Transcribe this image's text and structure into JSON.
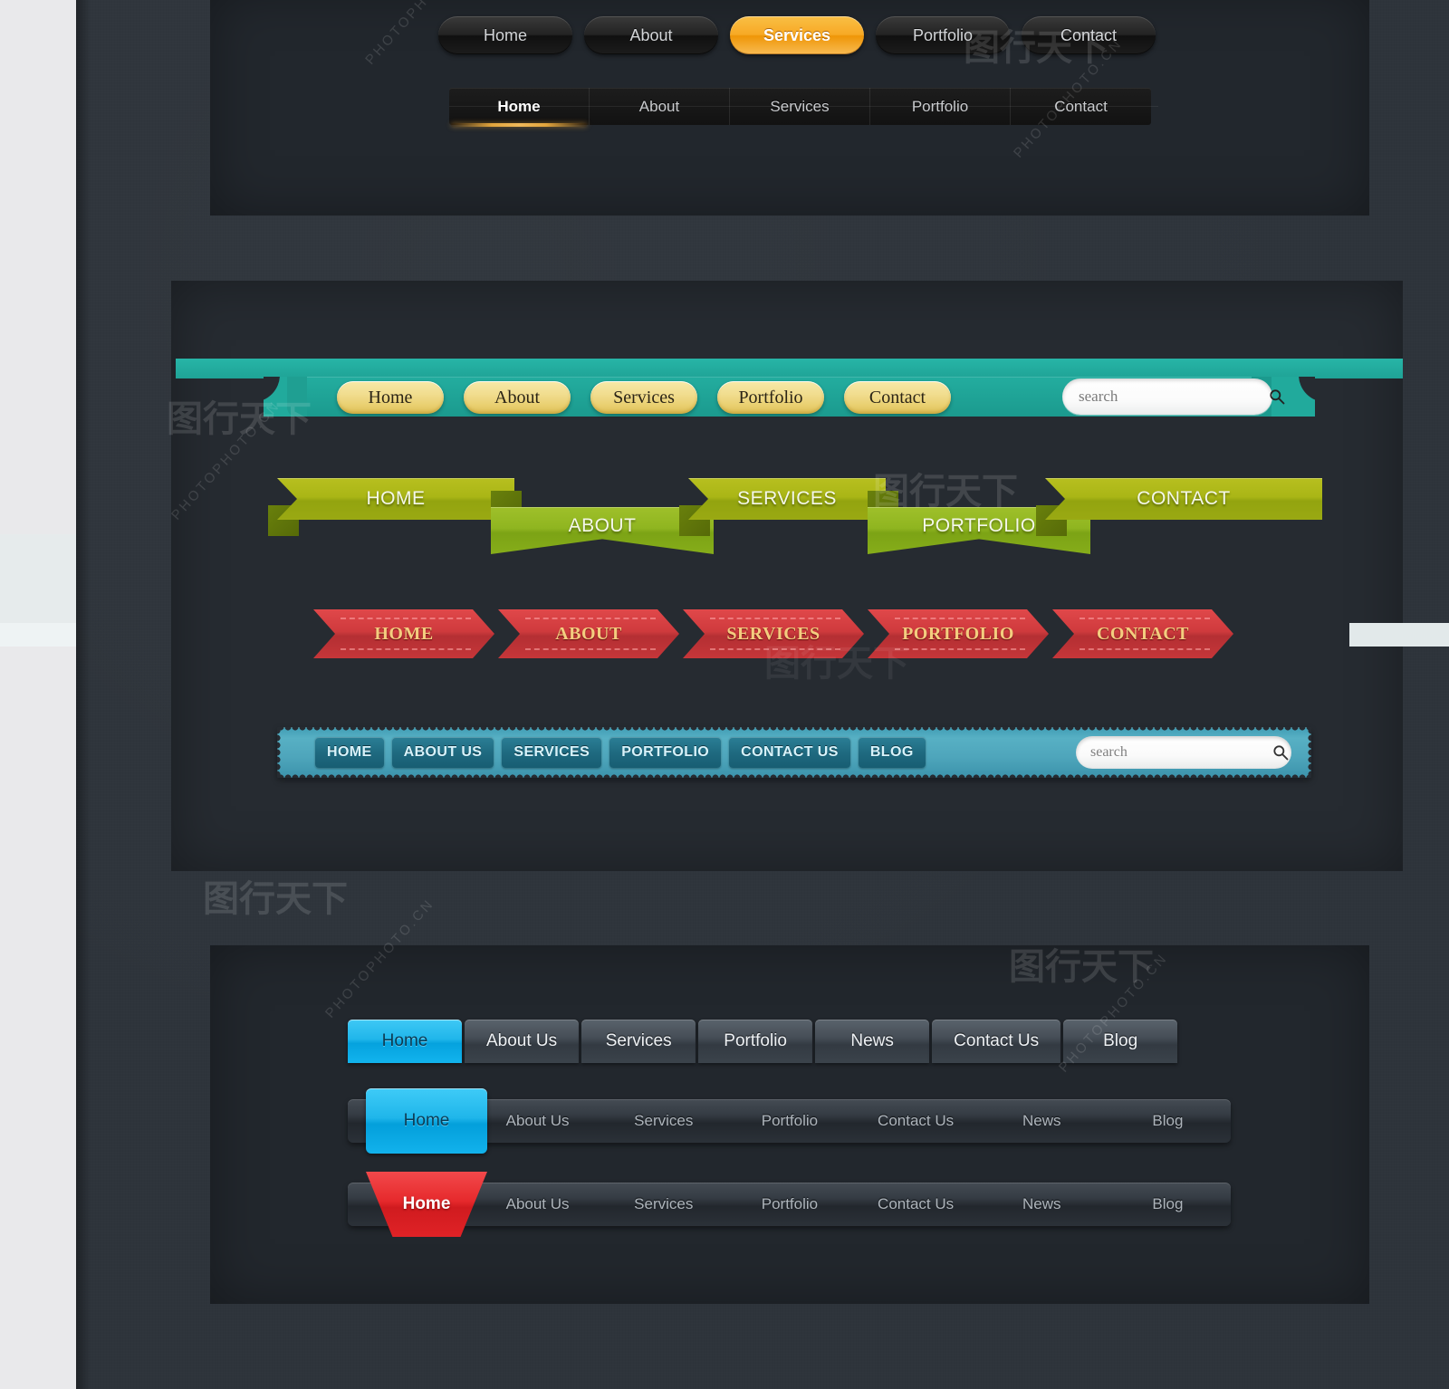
{
  "theme": {
    "page_bg": "#e9e9eb",
    "body_bg": "#2e343b",
    "panel_bg": "#22272d",
    "accent_orange": "#f7a925",
    "accent_teal": "#21aa9c",
    "accent_gold": "#f1dd8f",
    "accent_green": "#aab616",
    "accent_red": "#cf3a3d",
    "accent_blue": "#4ea5bb",
    "accent_cyan": "#20b6ea",
    "accent_tab_red": "#e6292c"
  },
  "watermarks": [
    {
      "text": "PHOTOPHOTO",
      "kind": "text"
    },
    {
      "text": "PHOTOPHOTO.CN",
      "kind": "text"
    },
    {
      "text": "图行天下",
      "kind": "cn"
    },
    {
      "text": "PHOTOPHOTO.CN",
      "kind": "text"
    }
  ],
  "nav_pills": {
    "name": "dark-glossy-pill-nav",
    "items": [
      {
        "label": "Home",
        "active": false
      },
      {
        "label": "About",
        "active": false
      },
      {
        "label": "Services",
        "active": true
      },
      {
        "label": "Portfolio",
        "active": false
      },
      {
        "label": "Contact",
        "active": false
      }
    ]
  },
  "nav_dark_tabs": {
    "name": "dark-underline-tab-nav",
    "items": [
      {
        "label": "Home",
        "active": true
      },
      {
        "label": "About",
        "active": false
      },
      {
        "label": "Services",
        "active": false
      },
      {
        "label": "Portfolio",
        "active": false
      },
      {
        "label": "Contact",
        "active": false
      }
    ]
  },
  "nav_teal": {
    "name": "teal-ribbon-gold-pill-nav",
    "items": [
      {
        "label": "Home"
      },
      {
        "label": "About"
      },
      {
        "label": "Services"
      },
      {
        "label": "Portfolio"
      },
      {
        "label": "Contact"
      }
    ],
    "search": {
      "placeholder": "search",
      "value": "",
      "icon": "search-icon"
    }
  },
  "nav_green": {
    "name": "green-ribbon-nav",
    "items": [
      {
        "label": "HOME",
        "position": "up"
      },
      {
        "label": "ABOUT",
        "position": "down"
      },
      {
        "label": "SERVICES",
        "position": "up"
      },
      {
        "label": "PORTFOLIO",
        "position": "down"
      },
      {
        "label": "CONTACT",
        "position": "up"
      }
    ]
  },
  "nav_red": {
    "name": "red-chevron-ribbon-nav",
    "items": [
      {
        "label": "HOME"
      },
      {
        "label": "ABOUT"
      },
      {
        "label": "SERVICES"
      },
      {
        "label": "PORTFOLIO"
      },
      {
        "label": "CONTACT"
      }
    ]
  },
  "nav_blue": {
    "name": "blue-scalloped-bar-nav",
    "items": [
      {
        "label": "HOME"
      },
      {
        "label": "ABOUT US"
      },
      {
        "label": "SERVICES"
      },
      {
        "label": "PORTFOLIO"
      },
      {
        "label": "CONTACT US"
      },
      {
        "label": "BLOG"
      }
    ],
    "search": {
      "placeholder": "search",
      "value": "",
      "icon": "search-icon"
    }
  },
  "nav_sep_tabs": {
    "name": "separated-dark-tab-nav",
    "items": [
      {
        "label": "Home",
        "active": true
      },
      {
        "label": "About Us",
        "active": false
      },
      {
        "label": "Services",
        "active": false
      },
      {
        "label": "Portfolio",
        "active": false
      },
      {
        "label": "News",
        "active": false
      },
      {
        "label": "Contact Us",
        "active": false
      },
      {
        "label": "Blog",
        "active": false
      }
    ]
  },
  "nav_flat_cyan": {
    "name": "flat-bar-cyan-active-nav",
    "active_label": "Home",
    "items": [
      {
        "label": "About Us"
      },
      {
        "label": "Services"
      },
      {
        "label": "Portfolio"
      },
      {
        "label": "Contact Us"
      },
      {
        "label": "News"
      },
      {
        "label": "Blog"
      }
    ]
  },
  "nav_flat_red": {
    "name": "flat-bar-red-active-nav",
    "active_label": "Home",
    "items": [
      {
        "label": "About Us"
      },
      {
        "label": "Services"
      },
      {
        "label": "Portfolio"
      },
      {
        "label": "Contact Us"
      },
      {
        "label": "News"
      },
      {
        "label": "Blog"
      }
    ]
  }
}
